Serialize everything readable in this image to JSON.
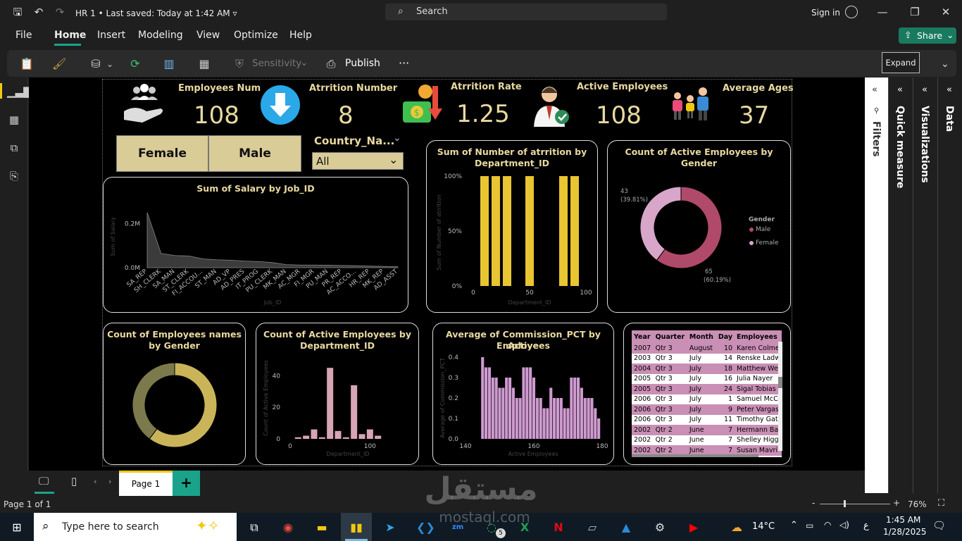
{
  "titlebar": {
    "file_title": "HR 1",
    "separator": "•",
    "last_saved": "Last saved: Today at 1:42 AM",
    "search": "Search",
    "signin": "Sign in"
  },
  "menu": {
    "items": [
      "File",
      "Home",
      "Insert",
      "Modeling",
      "View",
      "Optimize",
      "Help"
    ],
    "active": "Home",
    "share": "Share"
  },
  "ribbon": {
    "sensitivity": "Sensitivity",
    "publish": "Publish",
    "more": "···",
    "expand_tooltip": "Expand"
  },
  "kpis": [
    {
      "label": "Employees Num",
      "value": "108"
    },
    {
      "label": "Atrrition Number",
      "value": "8"
    },
    {
      "label": "Atrrition Rate",
      "value": "1.25"
    },
    {
      "label": "Active Employees",
      "value": "108"
    },
    {
      "label": "Average Ages",
      "value": "37"
    }
  ],
  "slicers": {
    "gender_buttons": [
      "Female",
      "Male"
    ],
    "country_label": "Country_Na...",
    "country_value": "All"
  },
  "charts": {
    "salary": {
      "title": "Sum of Salary by Job_ID",
      "ylabel": "Sum of Salary",
      "xlabel": "Job_ID",
      "y_ticks": [
        "0.2M",
        "0.0M"
      ]
    },
    "attrition": {
      "title_l1": "Sum of Number of atrrition by",
      "title_l2": "Department_ID",
      "ylabel": "Sum of Number of atrrition",
      "xlabel": "Department_ID",
      "y_ticks": [
        "100%",
        "50%",
        "0%"
      ],
      "x_ticks": [
        "0",
        "50",
        "100"
      ]
    },
    "gender_active": {
      "title": "Count of Active Employees by Gender",
      "legend_title": "Gender",
      "male_label": "65",
      "male_pct": "(60.19%)",
      "female_label": "43",
      "female_pct": "(39.81%)"
    },
    "names_gender": {
      "title_l1": "Count of Employees names",
      "title_l2": "by Gender"
    },
    "active_dept": {
      "title_l1": "Count of Active Employees by",
      "title_l2": "Department_ID",
      "ylabel": "Count of Active Employees",
      "xlabel": "Department_ID",
      "y_ticks": [
        "40",
        "20",
        "0"
      ],
      "x_ticks": [
        "0",
        "100"
      ]
    },
    "commission": {
      "title_l1": "Average of Commission_PCT by Active",
      "title_l2": "Employees",
      "ylabel": "Average of Commission_PCT",
      "xlabel": "Active Employees",
      "y_ticks": [
        "0.4",
        "0.3",
        "0.2",
        "0.1",
        "0.0"
      ],
      "x_ticks": [
        "140",
        "160",
        "180"
      ]
    }
  },
  "chart_data": [
    {
      "type": "area",
      "title": "Sum of Salary by Job_ID",
      "xlabel": "Job_ID",
      "ylabel": "Sum of Salary",
      "categories": [
        "SA_REP",
        "SH_CLERK",
        "SA_MAN",
        "ST_CLERK",
        "FI_ACCOU...",
        "ST_MAN",
        "AD_VP",
        "AD_PRES",
        "IT_PROG",
        "PU_CLERK",
        "MK_MAN",
        "AC_MGR",
        "FI_MGR",
        "PU_MAN",
        "PR_REP",
        "AC_ACCO...",
        "HR_REP",
        "MK_REP",
        "AD_ASST"
      ],
      "values": [
        250000,
        64000,
        55000,
        53000,
        40000,
        36000,
        34000,
        30000,
        28000,
        23000,
        14000,
        12000,
        12000,
        11000,
        10000,
        9000,
        7000,
        6000,
        4400
      ],
      "ylim": [
        0,
        300000
      ]
    },
    {
      "type": "bar",
      "title": "Sum of Number of atrrition by Department_ID",
      "xlabel": "Department_ID",
      "ylabel": "Sum of Number of atrrition",
      "x": [
        10,
        20,
        30,
        50,
        80,
        90
      ],
      "values": [
        100,
        100,
        100,
        100,
        100,
        100
      ],
      "xlim": [
        0,
        100
      ],
      "ylim": [
        0,
        100
      ]
    },
    {
      "type": "pie",
      "title": "Count of Active Employees by Gender",
      "series": [
        {
          "name": "Male",
          "value": 65,
          "color": "#b04a6a"
        },
        {
          "name": "Female",
          "value": 43,
          "color": "#d7a6c9"
        }
      ]
    },
    {
      "type": "pie",
      "title": "Count of Employees names by Gender",
      "series": [
        {
          "value": 65,
          "color": "#c9b45a"
        },
        {
          "value": 43,
          "color": "#7c7a4c"
        }
      ]
    },
    {
      "type": "bar",
      "title": "Count of Active Employees by Department_ID",
      "xlabel": "Department_ID",
      "ylabel": "Count of Active Employees",
      "x": [
        10,
        20,
        30,
        40,
        50,
        60,
        70,
        80,
        90,
        100,
        110
      ],
      "values": [
        1,
        2,
        6,
        1,
        45,
        5,
        1,
        34,
        3,
        6,
        2
      ],
      "xlim": [
        0,
        120
      ],
      "ylim": [
        0,
        50
      ]
    },
    {
      "type": "bar",
      "title": "Average of Commission_PCT by Active Employees",
      "xlabel": "Active Employees",
      "ylabel": "Average of Commission_PCT",
      "x": [
        145,
        146,
        147,
        148,
        149,
        150,
        151,
        152,
        153,
        154,
        155,
        156,
        157,
        158,
        159,
        160,
        161,
        162,
        163,
        164,
        165,
        166,
        167,
        168,
        169,
        170,
        171,
        172,
        173,
        174,
        175,
        176,
        177,
        178,
        179
      ],
      "values": [
        0.4,
        0.35,
        0.35,
        0.3,
        0.3,
        0.25,
        0.25,
        0.3,
        0.3,
        0.25,
        0.2,
        0.2,
        0.35,
        0.35,
        0.35,
        0.3,
        0.2,
        0.2,
        0.15,
        0.15,
        0.25,
        0.2,
        0.2,
        0.2,
        0.15,
        0.15,
        0.3,
        0.3,
        0.3,
        0.25,
        0.2,
        0.2,
        0.2,
        0.15,
        0.1
      ],
      "xlim": [
        140,
        180
      ],
      "ylim": [
        0,
        0.4
      ]
    }
  ],
  "table": {
    "headers": [
      "Year",
      "Quarter",
      "Month",
      "Day",
      "Employees"
    ],
    "rows": [
      [
        "2007",
        "Qtr 3",
        "August",
        "10",
        "Karen Colme"
      ],
      [
        "2003",
        "Qtr 3",
        "July",
        "14",
        "Renske Ladw"
      ],
      [
        "2004",
        "Qtr 3",
        "July",
        "18",
        "Matthew We"
      ],
      [
        "2005",
        "Qtr 3",
        "July",
        "16",
        "Julia Nayer"
      ],
      [
        "2005",
        "Qtr 3",
        "July",
        "24",
        "Sigal Tobias"
      ],
      [
        "2006",
        "Qtr 3",
        "July",
        "1",
        "Samuel McC"
      ],
      [
        "2006",
        "Qtr 3",
        "July",
        "9",
        "Peter Vargas"
      ],
      [
        "2006",
        "Qtr 3",
        "July",
        "11",
        "Timothy Gat"
      ],
      [
        "2002",
        "Qtr 2",
        "June",
        "7",
        "Hermann Ba"
      ],
      [
        "2002",
        "Qtr 2",
        "June",
        "7",
        "Shelley Higg"
      ],
      [
        "2002",
        "Qtr 2",
        "June",
        "7",
        "Susan Mavri"
      ]
    ]
  },
  "panes": {
    "filters": "Filters",
    "quick_measure": "Quick measure",
    "visualizations": "Visualizations",
    "data": "Data"
  },
  "pages": {
    "tab": "Page 1",
    "add": "+"
  },
  "status": {
    "page_info": "Page 1 of 1",
    "zoom": "76%",
    "minus": "-",
    "plus": "+"
  },
  "taskbar": {
    "search_placeholder": "Type here to search",
    "temp": "14°C",
    "time": "1:45 AM",
    "date": "1/28/2025",
    "lang": "ع",
    "badge": "5"
  },
  "watermark": {
    "text_ar": "مستقل",
    "text_en": "mostaql.com"
  }
}
